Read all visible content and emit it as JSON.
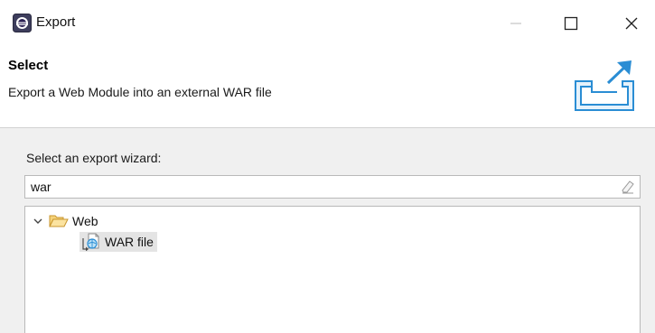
{
  "window": {
    "title": "Export",
    "icons": {
      "app": "eclipse-icon",
      "minimize": "minimize-icon",
      "maximize": "maximize-icon",
      "close": "close-icon"
    }
  },
  "header": {
    "title": "Select",
    "description": "Export a Web Module into an external WAR file",
    "banner_icon": "export-wizard-icon"
  },
  "wizard": {
    "label": "Select an export wizard:",
    "filter": {
      "value": "war",
      "placeholder": "",
      "clear_icon": "eraser-icon"
    },
    "tree": [
      {
        "label": "Web",
        "expanded": true,
        "icon": "open-folder-icon",
        "children": [
          {
            "label": "WAR file",
            "selected": true,
            "icon": "war-file-icon"
          }
        ]
      }
    ]
  },
  "colors": {
    "accent_blue": "#2a8dd4",
    "folder_yellow": "#e8b84a",
    "selection_gray": "#e4e4e4",
    "panel_gray": "#f0f0f0"
  }
}
